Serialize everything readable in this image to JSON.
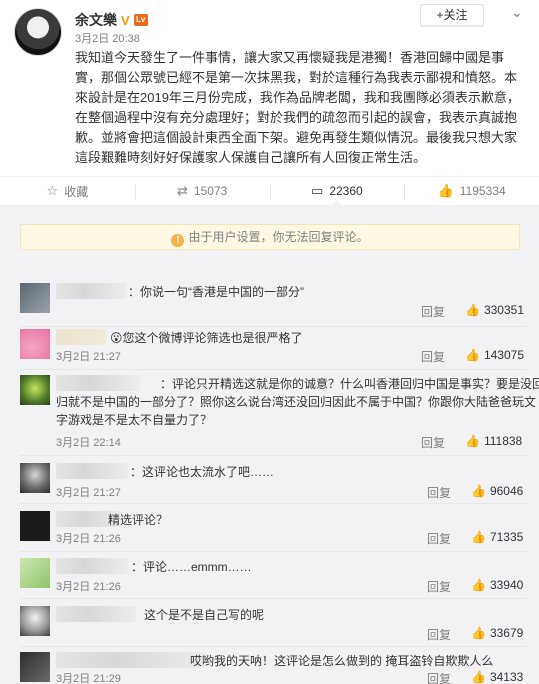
{
  "post": {
    "author": "余文樂",
    "verified_badge": "V",
    "level_badge": "Lv",
    "follow_label": "+关注",
    "menu_icon": "chevron-down-icon",
    "time": "3月2日 20:38",
    "body": "我知道今天發生了一件事情，讓大家又再懷疑我是港獨！香港回歸中國是事實，那個公眾號已經不是第一次抹黑我，對於這種行為我表示鄙視和憤怒。本來設計是在2019年三月份完成，我作為品牌老闆，我和我團隊必須表示歉意，在整個過程中沒有充分處理好；對於我們的疏忽而引起的誤會，我表示真誠抱歉。並將會把這個設計東西全面下架。避免再發生類似情況。最後我只想大家這段艱難時刻好好保護家人保護自己讓所有人回復正常生活。"
  },
  "actions": {
    "favorite_label": "收藏",
    "repost_count": "15073",
    "comment_count": "22360",
    "like_count": "1195334"
  },
  "notice": "由于用户设置，你无法回复评论。",
  "reply_label": "回复",
  "comments": [
    {
      "text": "：你说一句“香港是中国的一部分”",
      "time": "",
      "likes": "330351"
    },
    {
      "text": "😮您这个微博评论筛选也是很严格了",
      "time": "3月2日 21:27",
      "likes": "143075"
    },
    {
      "text": "：评论只开精选这就是你的诚意？什么叫香港回归中国是事实？要是没回归就不是中国的一部分了？照你这么说台湾还没回归因此不属于中国？你跟你大陆爸爸玩文字游戏是不是太不自量力了？",
      "time": "3月2日 22:14",
      "likes": "111838"
    },
    {
      "text": "：这评论也太流水了吧……",
      "time": "3月2日 21:27",
      "likes": "96046"
    },
    {
      "text": "精选评论？",
      "time": "3月2日 21:26",
      "likes": "71335"
    },
    {
      "text": "：评论……emmm……",
      "time": "3月2日 21:26",
      "likes": "33940"
    },
    {
      "text": "这个是不是自己写的呢",
      "time": "3月2日 21:26",
      "likes": "33679"
    },
    {
      "text": "哎哟我的天呐！这评论是怎么做到的 掩耳盗铃自欺欺人么",
      "time": "3月2日 21:29",
      "likes": "34133"
    }
  ]
}
